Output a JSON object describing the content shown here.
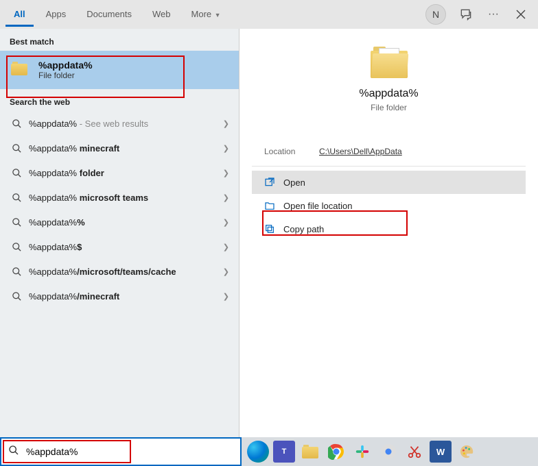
{
  "header": {
    "tabs": [
      "All",
      "Apps",
      "Documents",
      "Web",
      "More"
    ],
    "avatar_initial": "N"
  },
  "left": {
    "best_label": "Best match",
    "best_title": "%appdata%",
    "best_sub": "File folder",
    "web_label": "Search the web",
    "rows": [
      {
        "pre": "%appdata%",
        "bold": "",
        "post": "",
        "suffix": " - See web results",
        "grey": true
      },
      {
        "pre": "%appdata% ",
        "bold": "minecraft",
        "post": "",
        "suffix": ""
      },
      {
        "pre": "%appdata% ",
        "bold": "folder",
        "post": "",
        "suffix": ""
      },
      {
        "pre": "%appdata% ",
        "bold": "microsoft teams",
        "post": "",
        "suffix": ""
      },
      {
        "pre": "%appdata%",
        "bold": "%",
        "post": "",
        "suffix": ""
      },
      {
        "pre": "%appdata%",
        "bold": "$",
        "post": "",
        "suffix": ""
      },
      {
        "pre": "%appdata%",
        "bold": "/microsoft/teams/cache",
        "post": "",
        "suffix": ""
      },
      {
        "pre": "%appdata%",
        "bold": "/minecraft",
        "post": "",
        "suffix": ""
      }
    ]
  },
  "right": {
    "title": "%appdata%",
    "sub": "File folder",
    "location_label": "Location",
    "location_value": "C:\\Users\\Dell\\AppData",
    "actions": [
      {
        "label": "Open",
        "icon": "open",
        "selected": true
      },
      {
        "label": "Open file location",
        "icon": "location",
        "selected": false
      },
      {
        "label": "Copy path",
        "icon": "copy",
        "selected": false
      }
    ]
  },
  "search_value": "%appdata%"
}
